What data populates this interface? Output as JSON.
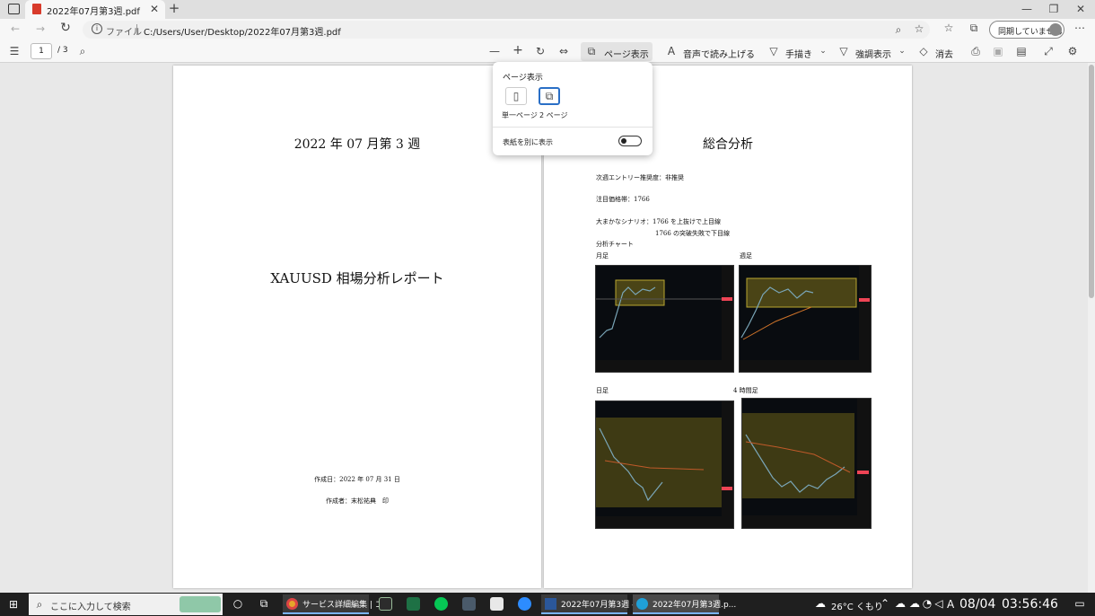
{
  "browser": {
    "tab_title": "2022年07月第3週.pdf",
    "address_prefix": "ファイル",
    "url": "C:/Users/User/Desktop/2022年07月第3週.pdf",
    "sync_label": "同期していません"
  },
  "pdf_toolbar": {
    "page_number": "1",
    "page_total": "/ 3",
    "page_view": "ページ表示",
    "read_aloud": "音声で読み上げる",
    "draw": "手描き",
    "highlight": "強調表示",
    "erase": "消去"
  },
  "popup": {
    "title": "ページ表示",
    "single": "単一ページ",
    "double": "2 ページ",
    "cover": "表紙を別に表示",
    "cover_on": false
  },
  "page1": {
    "week": "2022 年 07 月第 3 週",
    "title": "XAUUSD 相場分析レポート",
    "created": "作成日：2022 年 07 月 31 日",
    "author": "作成者：末松祐典　印"
  },
  "page2": {
    "heading": "総合分析",
    "line1": "次週エントリー推奨度：非推奨",
    "line2": "注目価格帯：1766",
    "line3": "大まかなシナリオ：1766 を上抜けで上目線",
    "line4": "1766 の突破失敗で下目線",
    "line5": "分析チャート",
    "monthly": "月足",
    "weekly": "週足",
    "daily": "日足",
    "h4": "4 時間足"
  },
  "taskbar": {
    "search_placeholder": "ここに入力して検索",
    "win1": "サービス詳細編集 | コ...",
    "win2": "2022年07月第3週 - ...",
    "win3": "2022年07月第3週.p...",
    "weather": "26°C くもり",
    "ime": "A",
    "date": "08/04",
    "time": "03:56:46"
  }
}
